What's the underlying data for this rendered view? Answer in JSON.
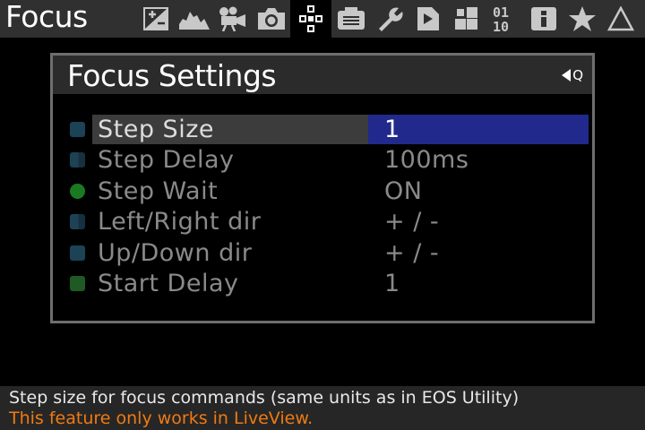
{
  "top_menu": {
    "title": "Focus",
    "tabs": [
      {
        "icon": "exposure-compensation-icon",
        "active": false
      },
      {
        "icon": "histogram-icon",
        "active": false
      },
      {
        "icon": "movie-camera-icon",
        "active": false
      },
      {
        "icon": "photo-camera-icon",
        "active": false
      },
      {
        "icon": "focus-points-icon",
        "active": true
      },
      {
        "icon": "display-icon",
        "active": false
      },
      {
        "icon": "wrench-icon",
        "active": false
      },
      {
        "icon": "play-script-icon",
        "active": false
      },
      {
        "icon": "modules-icon",
        "active": false
      },
      {
        "icon": "binary-debug-icon",
        "label": "01\n10",
        "active": false
      },
      {
        "icon": "info-icon",
        "active": false
      },
      {
        "icon": "star-icon",
        "active": false
      },
      {
        "icon": "delta-icon",
        "active": false
      }
    ]
  },
  "submenu": {
    "title": "Focus Settings",
    "q_button": "Q",
    "items": [
      {
        "name": "Step Size",
        "value": "1",
        "indicator": "blue",
        "selected": true
      },
      {
        "name": "Step Delay",
        "value": "100ms",
        "indicator": "half",
        "selected": false
      },
      {
        "name": "Step Wait",
        "value": "ON",
        "indicator": "green-dot",
        "selected": false
      },
      {
        "name": "Left/Right dir",
        "value": "+ / -",
        "indicator": "half",
        "selected": false
      },
      {
        "name": "Up/Down dir",
        "value": "+ / -",
        "indicator": "blue",
        "selected": false
      },
      {
        "name": "Start Delay",
        "value": "1",
        "indicator": "green",
        "selected": false
      }
    ]
  },
  "help": {
    "line1": "Step size for focus commands (same units as in EOS Utility)",
    "line2": "This feature only works in LiveView."
  },
  "colors": {
    "selected_value_bg": "#21298c",
    "warning_text": "#f07a12",
    "menu_bar_bg": "#303030"
  }
}
